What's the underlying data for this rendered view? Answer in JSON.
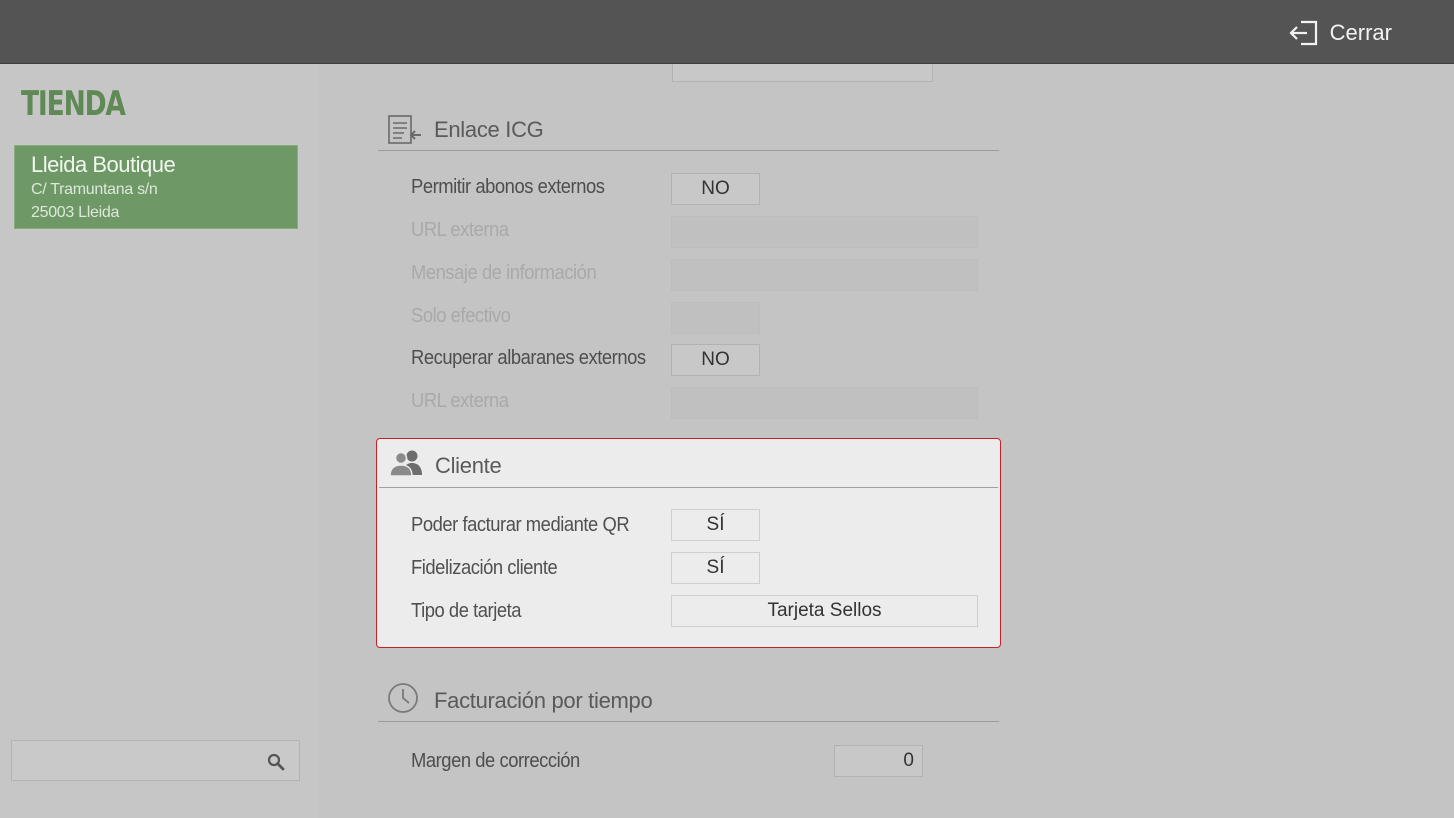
{
  "topbar": {
    "close_label": "Cerrar",
    "close_icon": "exit-icon"
  },
  "sidebar": {
    "title": "TIENDA",
    "store": {
      "name": "Lleida Boutique",
      "address": "C/ Tramuntana s/n",
      "city": "25003 Lleida"
    },
    "search": {
      "placeholder": "",
      "icon": "search-icon"
    }
  },
  "sections": {
    "enlace": {
      "title": "Enlace ICG",
      "icon": "document-link-icon",
      "rows": [
        {
          "label": "Permitir abonos externos",
          "value": "NO",
          "enabled": true
        },
        {
          "label": "URL externa",
          "value": "",
          "enabled": false
        },
        {
          "label": "Mensaje de información",
          "value": "",
          "enabled": false
        },
        {
          "label": "Solo efectivo",
          "value": "",
          "enabled": false
        },
        {
          "label": "Recuperar albaranes externos",
          "value": "NO",
          "enabled": true
        },
        {
          "label": "URL externa",
          "value": "",
          "enabled": false
        }
      ]
    },
    "cliente": {
      "title": "Cliente",
      "icon": "users-icon",
      "rows": [
        {
          "label": "Poder facturar mediante QR",
          "value": "SÍ"
        },
        {
          "label": "Fidelización cliente",
          "value": "SÍ"
        },
        {
          "label": "Tipo de tarjeta",
          "value": "Tarjeta Sellos"
        }
      ]
    },
    "facturacion": {
      "title": "Facturación por tiempo",
      "icon": "clock-icon",
      "rows": [
        {
          "label": "Margen de corrección",
          "value": "0"
        }
      ]
    }
  }
}
